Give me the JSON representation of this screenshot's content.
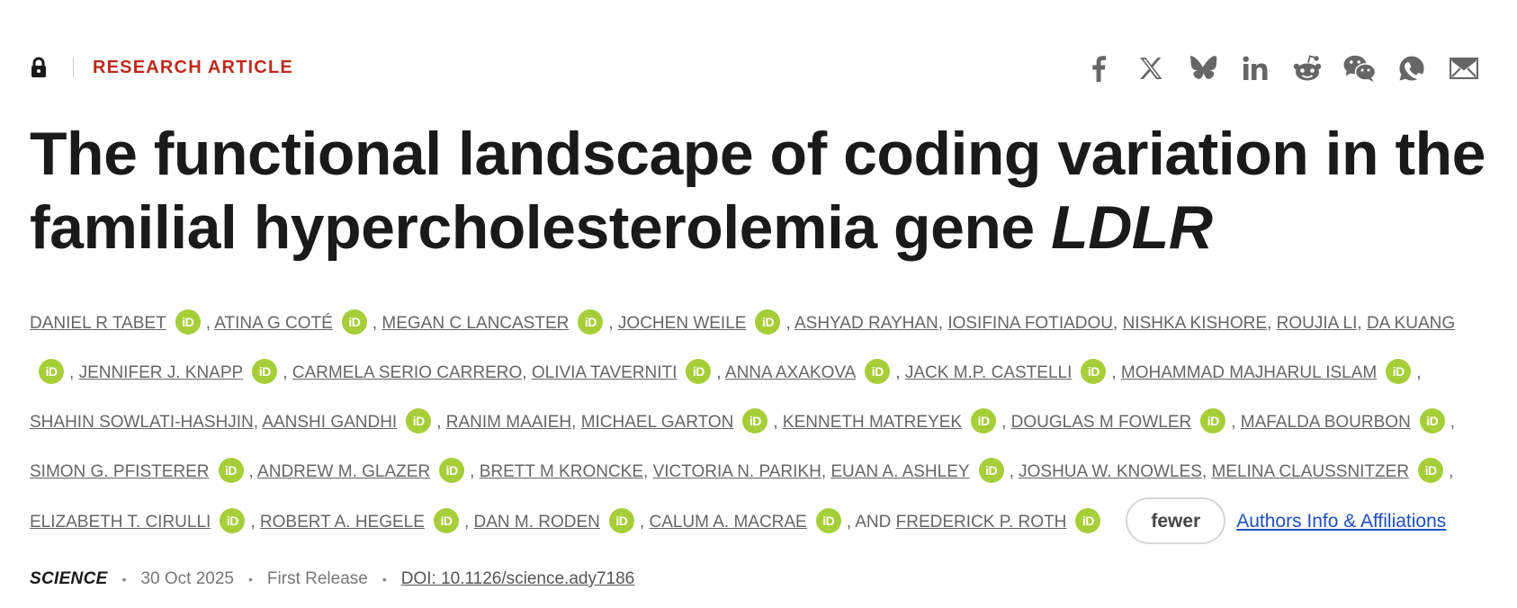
{
  "header": {
    "article_type": "RESEARCH ARTICLE",
    "access_icon": "lock-icon"
  },
  "share": [
    {
      "icon": "facebook-icon"
    },
    {
      "icon": "x-twitter-icon"
    },
    {
      "icon": "bluesky-icon"
    },
    {
      "icon": "linkedin-icon"
    },
    {
      "icon": "reddit-icon"
    },
    {
      "icon": "wechat-icon"
    },
    {
      "icon": "whatsapp-icon"
    },
    {
      "icon": "email-icon"
    }
  ],
  "title": {
    "main": "The functional landscape of coding variation in the familial hypercholesterolemia gene ",
    "gene": "LDLR"
  },
  "authors": [
    {
      "name": "DANIEL R TABET",
      "orcid": true
    },
    {
      "name": "ATINA G COTÉ",
      "orcid": true
    },
    {
      "name": "MEGAN C LANCASTER",
      "orcid": true
    },
    {
      "name": "JOCHEN WEILE",
      "orcid": true
    },
    {
      "name": "ASHYAD RAYHAN",
      "orcid": false
    },
    {
      "name": "IOSIFINA FOTIADOU",
      "orcid": false
    },
    {
      "name": "NISHKA KISHORE",
      "orcid": false
    },
    {
      "name": "ROUJIA LI",
      "orcid": false
    },
    {
      "name": "DA KUANG",
      "orcid": true
    },
    {
      "name": "JENNIFER J. KNAPP",
      "orcid": true
    },
    {
      "name": "CARMELA SERIO CARRERO",
      "orcid": false
    },
    {
      "name": "OLIVIA TAVERNITI",
      "orcid": true
    },
    {
      "name": "ANNA AXAKOVA",
      "orcid": true
    },
    {
      "name": "JACK M.P. CASTELLI",
      "orcid": true
    },
    {
      "name": "MOHAMMAD MAJHARUL ISLAM",
      "orcid": true
    },
    {
      "name": "SHAHIN SOWLATI-HASHJIN",
      "orcid": false
    },
    {
      "name": "AANSHI GANDHI",
      "orcid": true
    },
    {
      "name": "RANIM MAAIEH",
      "orcid": false
    },
    {
      "name": "MICHAEL GARTON",
      "orcid": true
    },
    {
      "name": "KENNETH MATREYEK",
      "orcid": true
    },
    {
      "name": "DOUGLAS M FOWLER",
      "orcid": true
    },
    {
      "name": "MAFALDA BOURBON",
      "orcid": true
    },
    {
      "name": "SIMON G. PFISTERER",
      "orcid": true
    },
    {
      "name": "ANDREW M. GLAZER",
      "orcid": true
    },
    {
      "name": "BRETT M KRONCKE",
      "orcid": false
    },
    {
      "name": "VICTORIA N. PARIKH",
      "orcid": false
    },
    {
      "name": "EUAN A. ASHLEY",
      "orcid": true
    },
    {
      "name": "JOSHUA W. KNOWLES",
      "orcid": false
    },
    {
      "name": "MELINA CLAUSSNITZER",
      "orcid": true
    },
    {
      "name": "ELIZABETH T. CIRULLI",
      "orcid": true
    },
    {
      "name": "ROBERT A. HEGELE",
      "orcid": true
    },
    {
      "name": "DAN M. RODEN",
      "orcid": true
    },
    {
      "name": "CALUM A. MACRAE",
      "orcid": true
    },
    {
      "name": "FREDERICK P. ROTH",
      "orcid": true
    }
  ],
  "authors_ui": {
    "orcid_label": "iD",
    "and_word": "AND",
    "fewer_label": "fewer",
    "affiliations_label": "Authors Info & Affiliations"
  },
  "meta": {
    "journal": "SCIENCE",
    "date": "30 Oct 2025",
    "status": "First Release",
    "doi": "DOI: 10.1126/science.ady7186"
  },
  "colors": {
    "accent_red": "#bf2a1e",
    "orcid_green": "#a6ce39",
    "link_blue": "#1f4fbf"
  }
}
